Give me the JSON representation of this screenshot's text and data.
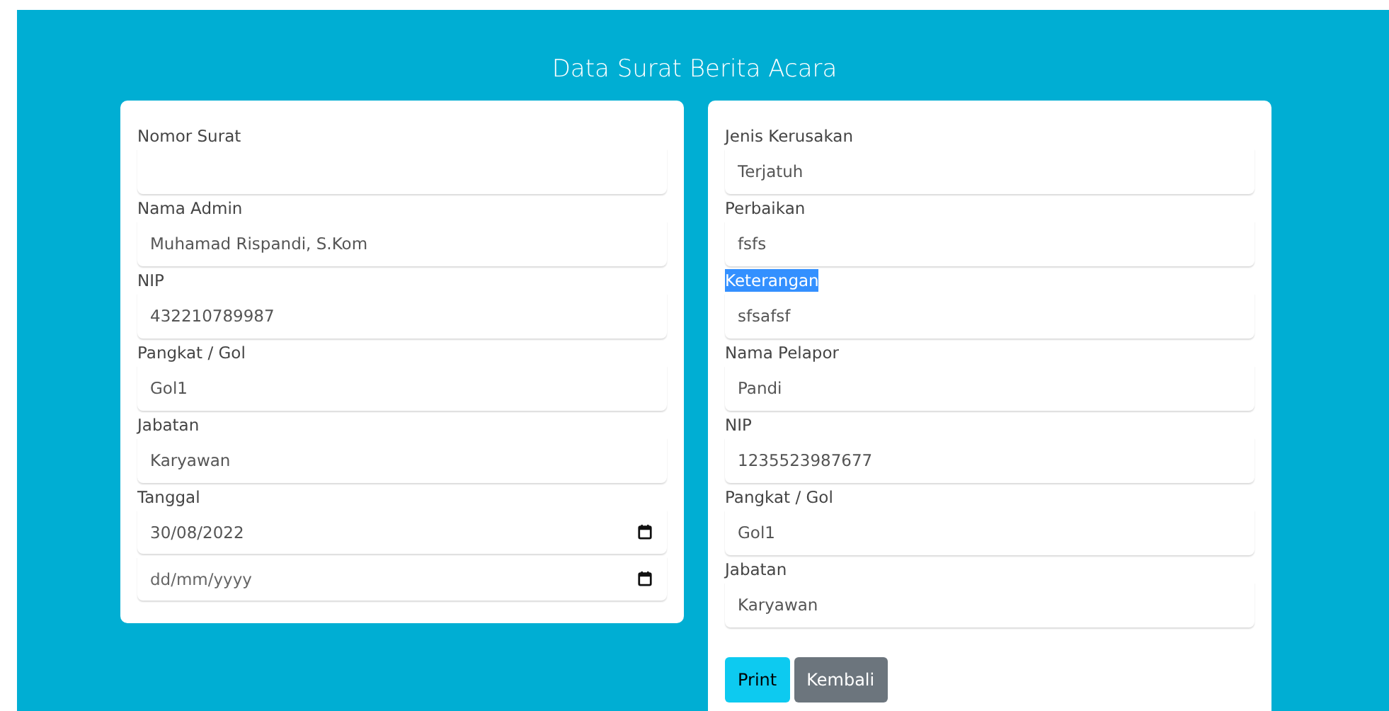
{
  "title": "Data Surat Berita Acara",
  "left_card": {
    "fields": [
      {
        "kind": "text",
        "label": "Nomor Surat"
      },
      {
        "kind": "text",
        "label": "Nama Admin",
        "value": "Muhamad Rispandi, S.Kom"
      },
      {
        "kind": "text",
        "label": "NIP",
        "value": "432210789987"
      },
      {
        "kind": "text",
        "label": "Pangkat / Gol",
        "value": "Gol1"
      },
      {
        "kind": "text",
        "label": "Jabatan",
        "value": "Karyawan"
      },
      {
        "kind": "date",
        "label": "Tanggal",
        "value": "30/08/2022"
      },
      {
        "kind": "date",
        "placeholder": "dd/mm/yyyy"
      }
    ]
  },
  "right_card": {
    "fields": [
      {
        "kind": "text",
        "label": "Jenis Kerusakan",
        "value": "Terjatuh",
        "highlighted": false
      },
      {
        "kind": "text",
        "label": "Perbaikan",
        "value": "fsfs",
        "highlighted": false
      },
      {
        "kind": "text",
        "label": "Keterangan",
        "value": "sfsafsf",
        "highlighted": true
      },
      {
        "kind": "text",
        "label": "Nama Pelapor",
        "value": "Pandi",
        "highlighted": false
      },
      {
        "kind": "text",
        "label": "NIP",
        "value": "1235523987677",
        "highlighted": false
      },
      {
        "kind": "text",
        "label": "Pangkat / Gol",
        "value": "Gol1",
        "highlighted": false
      },
      {
        "kind": "text",
        "label": "Jabatan",
        "value": "Karyawan",
        "highlighted": false
      }
    ],
    "buttons": [
      {
        "kind": "primary",
        "label": "Print"
      },
      {
        "kind": "secondary",
        "label": "Kembali"
      }
    ]
  }
}
